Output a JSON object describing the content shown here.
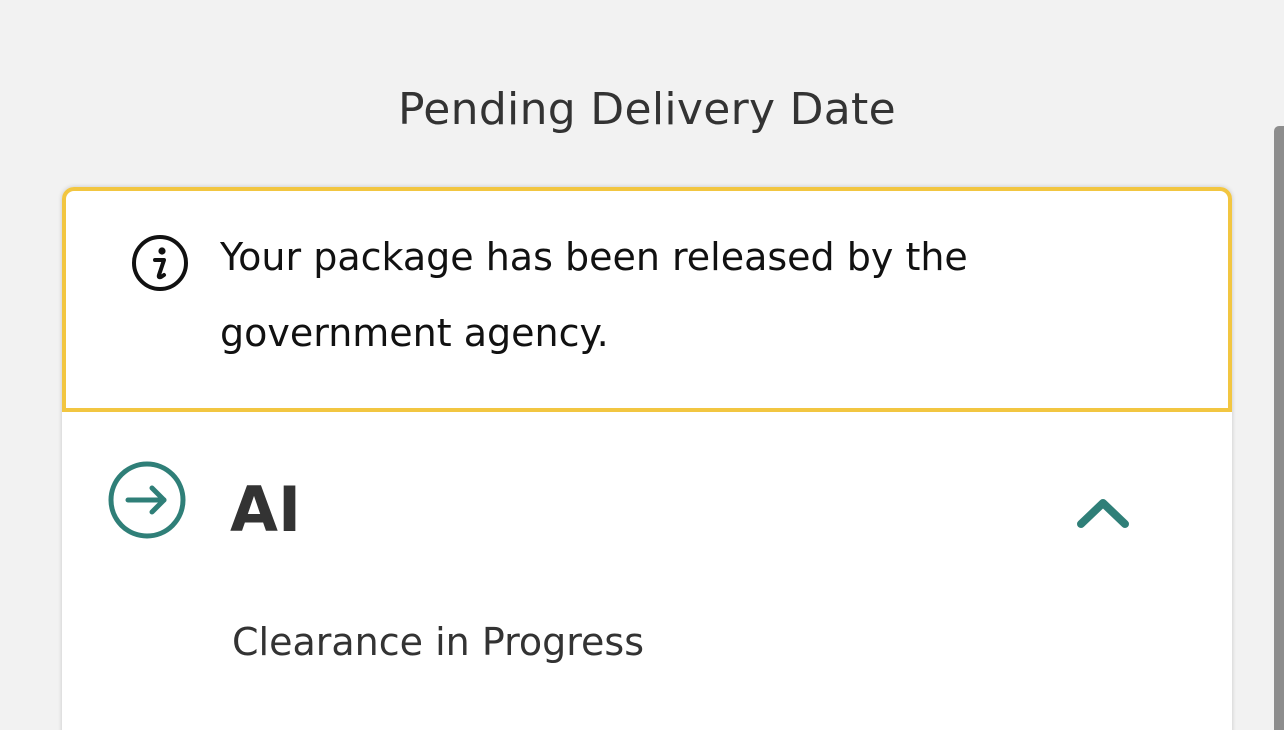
{
  "header": {
    "title": "Pending Delivery Date"
  },
  "alert": {
    "icon": "info-icon",
    "message": "Your package has been released by the government agency.",
    "border_color": "#f2c641"
  },
  "shipment_section": {
    "icon": "arrow-right-circle-icon",
    "code": "AI",
    "toggle_icon": "chevron-up-icon",
    "status": "Clearance in Progress",
    "accent_color": "#2f7f78"
  }
}
